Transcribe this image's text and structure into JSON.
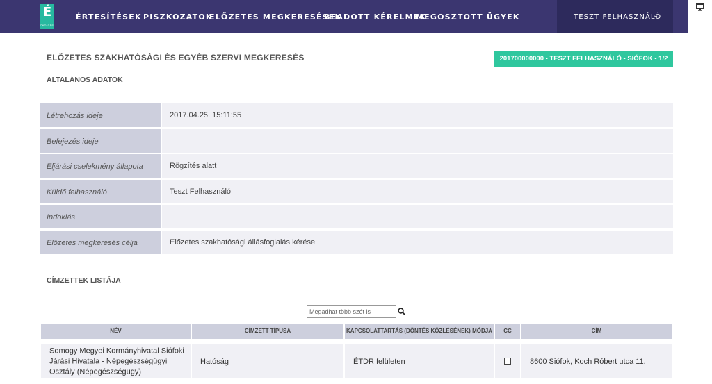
{
  "nav": {
    "logo_letter": "É",
    "logo_sub": "OKTATÁSI",
    "items": [
      "ÉRTESÍTÉSEK",
      "PISZKOZATOK",
      "ELŐZETES MEGKERESÉSEK",
      "BEADOTT KÉRELMEK",
      "MEGOSZTOTT ÜGYEK"
    ],
    "user_name": "TESZT FELHASZNÁLÓ",
    "user_chevron": "⌄"
  },
  "header": {
    "title": "ELŐZETES SZAKHATÓSÁGI ÉS EGYÉB SZERVI MEGKERESÉS",
    "case_badge": "201700000000 - TESZT FELHASZNÁLÓ - SIÓFOK - 1/2"
  },
  "general": {
    "title": "ÁLTALÁNOS ADATOK",
    "rows": [
      {
        "label": "Létrehozás ideje",
        "value": "2017.04.25. 15:11:55"
      },
      {
        "label": "Befejezés ideje",
        "value": ""
      },
      {
        "label": "Eljárási cselekmény állapota",
        "value": "Rögzítés alatt"
      },
      {
        "label": "Küldő felhasználó",
        "value": "Teszt Felhasználó"
      },
      {
        "label": "Indoklás",
        "value": ""
      },
      {
        "label": "Előzetes megkeresés célja",
        "value": "Előzetes szakhatósági állásfoglalás kérése"
      }
    ]
  },
  "recipients": {
    "title": "CÍMZETTEK LISTÁJA",
    "search_placeholder": "Megadhat több szót is",
    "columns": [
      "NÉV",
      "CÍMZETT TÍPUSA",
      "KAPCSOLATTARTÁS (DÖNTÉS KÖZLÉSÉNEK) MÓDJA",
      "CC",
      "CÍM"
    ],
    "rows": [
      {
        "name": "Somogy Megyei Kormányhivatal Siófoki Járási Hivatala - Népegészségügyi Osztály (Népegészségügy)",
        "type": "Hatóság",
        "contact": "ÉTDR felületen",
        "cc": false,
        "address": "8600 Siófok, Koch Róbert utca 11."
      }
    ]
  },
  "colors": {
    "nav_bg": "#3b3670",
    "user_menu_bg": "#2d2a5c",
    "accent": "#2fc79e",
    "label_bg": "#cdcfdd",
    "value_bg": "#f0f0f5"
  }
}
